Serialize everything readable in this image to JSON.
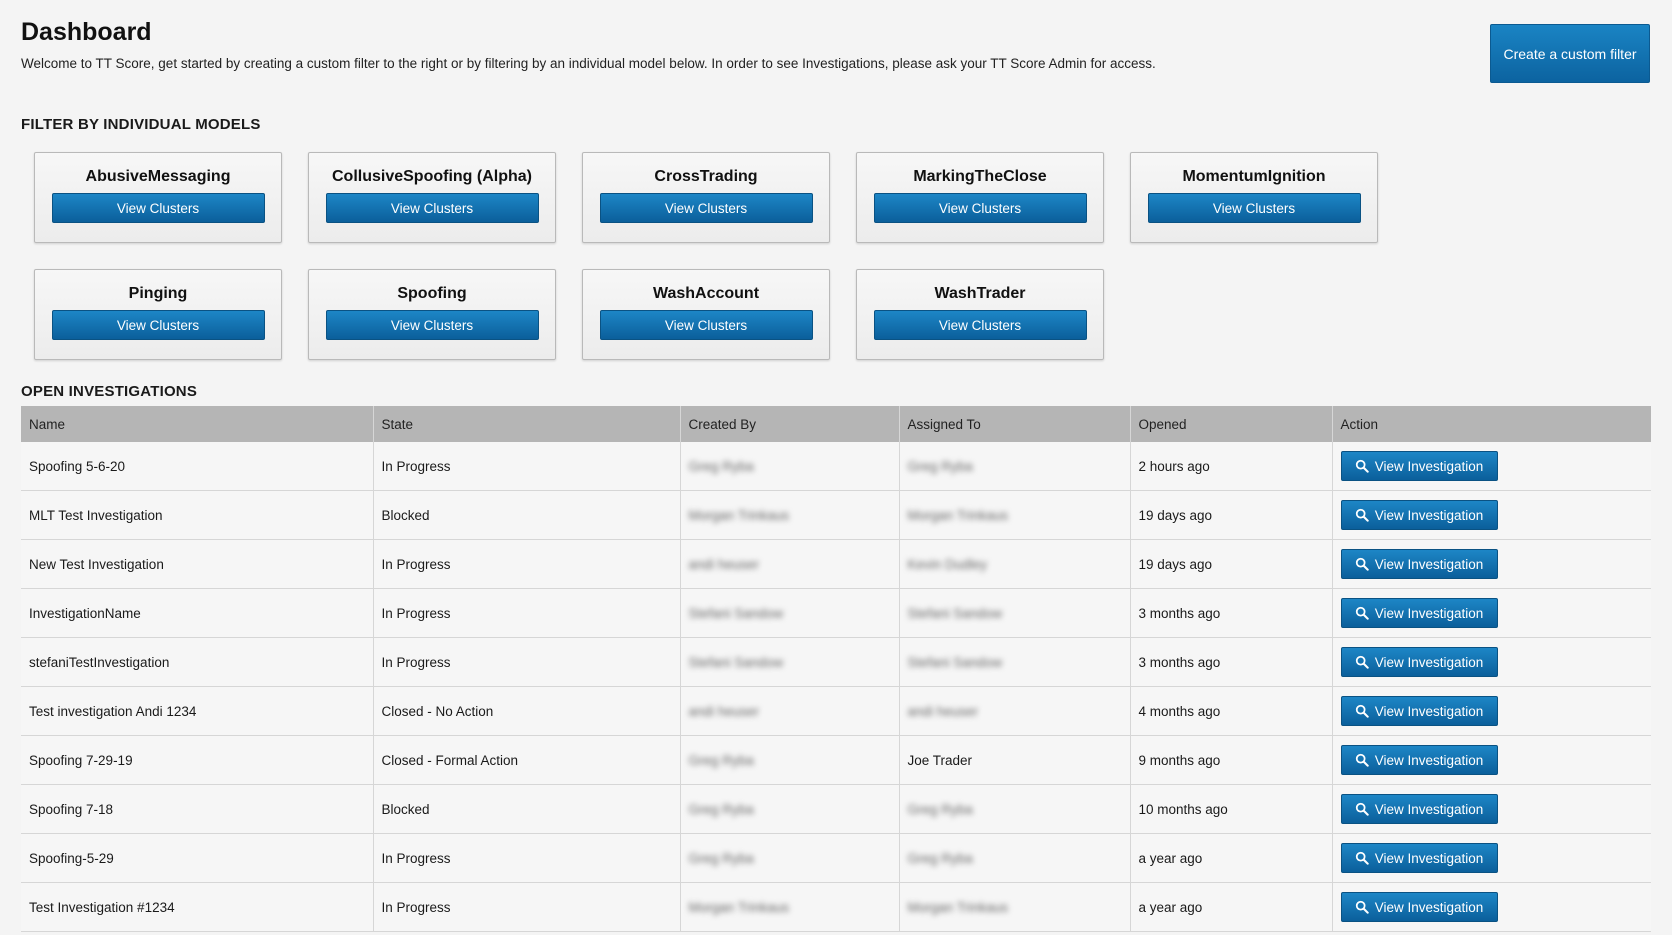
{
  "header": {
    "title": "Dashboard",
    "welcome": "Welcome to TT Score, get started by creating a custom filter to the right or by filtering by an individual model below. In order to see Investigations, please ask your TT Score Admin for access.",
    "custom_filter_label": "Create a custom filter"
  },
  "models": {
    "heading": "FILTER BY INDIVIDUAL MODELS",
    "button_label": "View Clusters",
    "items": [
      {
        "name": "AbusiveMessaging"
      },
      {
        "name": "CollusiveSpoofing (Alpha)"
      },
      {
        "name": "CrossTrading"
      },
      {
        "name": "MarkingTheClose"
      },
      {
        "name": "MomentumIgnition"
      },
      {
        "name": "Pinging"
      },
      {
        "name": "Spoofing"
      },
      {
        "name": "WashAccount"
      },
      {
        "name": "WashTrader"
      }
    ]
  },
  "investigations": {
    "heading": "OPEN INVESTIGATIONS",
    "columns": [
      "Name",
      "State",
      "Created By",
      "Assigned To",
      "Opened",
      "Action"
    ],
    "action_label": "View Investigation",
    "rows": [
      {
        "name": "Spoofing 5-6-20",
        "state": "In Progress",
        "created_by": "Greg Ryba",
        "assigned_to": "Greg Ryba",
        "opened": "2 hours ago",
        "created_blur": true,
        "assigned_blur": true
      },
      {
        "name": "MLT Test Investigation",
        "state": "Blocked",
        "created_by": "Morgan Trinkaus",
        "assigned_to": "Morgan Trinkaus",
        "opened": "19 days ago",
        "created_blur": true,
        "assigned_blur": true
      },
      {
        "name": "New Test Investigation",
        "state": "In Progress",
        "created_by": "andi heuser",
        "assigned_to": "Kevin Dudley",
        "opened": "19 days ago",
        "created_blur": true,
        "assigned_blur": true
      },
      {
        "name": "InvestigationName",
        "state": "In Progress",
        "created_by": "Stefani Sandow",
        "assigned_to": "Stefani Sandow",
        "opened": "3 months ago",
        "created_blur": true,
        "assigned_blur": true
      },
      {
        "name": "stefaniTestInvestigation",
        "state": "In Progress",
        "created_by": "Stefani Sandow",
        "assigned_to": "Stefani Sandow",
        "opened": "3 months ago",
        "created_blur": true,
        "assigned_blur": true
      },
      {
        "name": "Test investigation Andi 1234",
        "state": "Closed - No Action",
        "created_by": "andi heuser",
        "assigned_to": "andi heuser",
        "opened": "4 months ago",
        "created_blur": true,
        "assigned_blur": true
      },
      {
        "name": "Spoofing 7-29-19",
        "state": "Closed - Formal Action",
        "created_by": "Greg Ryba",
        "assigned_to": "Joe Trader",
        "opened": "9 months ago",
        "created_blur": true,
        "assigned_blur": false
      },
      {
        "name": "Spoofing 7-18",
        "state": "Blocked",
        "created_by": "Greg Ryba",
        "assigned_to": "Greg Ryba",
        "opened": "10 months ago",
        "created_blur": true,
        "assigned_blur": true
      },
      {
        "name": "Spoofing-5-29",
        "state": "In Progress",
        "created_by": "Greg Ryba",
        "assigned_to": "Greg Ryba",
        "opened": "a year ago",
        "created_blur": true,
        "assigned_blur": true
      },
      {
        "name": "Test Investigation #1234",
        "state": "In Progress",
        "created_by": "Morgan Trinkaus",
        "assigned_to": "Morgan Trinkaus",
        "opened": "a year ago",
        "created_blur": true,
        "assigned_blur": true
      }
    ]
  }
}
